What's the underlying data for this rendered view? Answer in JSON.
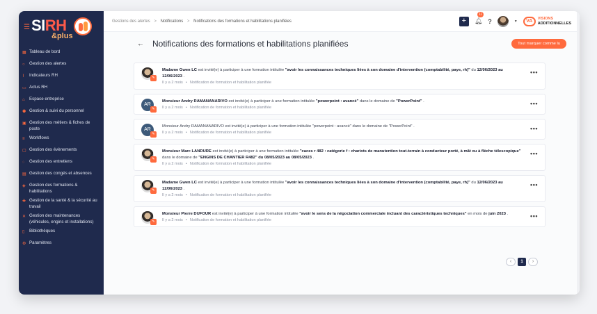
{
  "sidebar": {
    "logo_main": "SIRH",
    "logo_plus": "&plus",
    "items": [
      {
        "label": "Tableau de bord",
        "icon": "grid-icon"
      },
      {
        "label": "Gestion des alertes",
        "icon": "bell-icon"
      },
      {
        "label": "Indicateurs RH",
        "icon": "chart-icon"
      },
      {
        "label": "Actus RH",
        "icon": "news-icon"
      },
      {
        "label": "Espace entreprise",
        "icon": "building-icon"
      },
      {
        "label": "Gestion & suivi du personnel",
        "icon": "users-icon"
      },
      {
        "label": "Gestion des métiers & fiches de poste",
        "icon": "briefcase-icon"
      },
      {
        "label": "Workflows",
        "icon": "workflow-icon"
      },
      {
        "label": "Gestion des évènements",
        "icon": "calendar-icon"
      },
      {
        "label": "Gestion des entretiens",
        "icon": "chat-icon"
      },
      {
        "label": "Gestion des congés et absences",
        "icon": "calendar-off-icon"
      },
      {
        "label": "Gestion des formations & habilitations",
        "icon": "graduation-icon"
      },
      {
        "label": "Gestion de la santé & la sécurité au travail",
        "icon": "health-icon"
      },
      {
        "label": "Gestion des maintenances (véhicules, engins et installations)",
        "icon": "wrench-icon"
      },
      {
        "label": "Bibliothèques",
        "icon": "book-icon"
      },
      {
        "label": "Paramètres",
        "icon": "gear-icon"
      }
    ]
  },
  "breadcrumb": {
    "items": [
      "Gestions des alertes",
      "Notifications",
      "Notifications des formations et habilitations planifiées"
    ]
  },
  "topbar": {
    "notification_count": "11",
    "help": "?",
    "brand_line1": "VISIONS",
    "brand_line2": "ADDITIONNELLES",
    "brand_mark": "VA"
  },
  "page": {
    "title": "Notifications des formations et habilitations planifiées",
    "mark_all_label": "Tout marquer comme lu"
  },
  "notifications": [
    {
      "avatar": "photo",
      "initials": "",
      "name": "Madame Gwen LC",
      "text1": " est invité(e) à participer à une formation intitulée ",
      "training": "\"avoir les connaissances techniques liées à son domaine d'intervention (comptabilité, paye, rh)\"",
      "text2": " du ",
      "domain": "",
      "dates": "12/06/2023 au 12/06/2023",
      "ending": " .",
      "bold": true,
      "time": "Il y a 2 mois",
      "type": "Notification de formation et habilitation planifiée"
    },
    {
      "avatar": "initials",
      "initials": "AR",
      "name": "Monsieur Andry RAMANANARIVO",
      "text1": " est invité(e) à participer à une formation intitulée ",
      "training": "\"powerpoint : avancé\"",
      "text2": " dans le domaine de ",
      "domain": "\"PowerPoint\"",
      "dates": "",
      "ending": " .",
      "bold": true,
      "time": "Il y a 2 mois",
      "type": "Notification de formation et habilitation planifiée"
    },
    {
      "avatar": "initials",
      "initials": "AR",
      "name": "Monsieur Andry RAMANANARIVO",
      "text1": " est invité(e) à participer à une formation intitulée ",
      "training": "\"powerpoint : avancé\"",
      "text2": " dans le domaine de ",
      "domain": "\"PowerPoint\"",
      "dates": "",
      "ending": " .",
      "bold": false,
      "time": "Il y a 2 mois",
      "type": "Notification de formation et habilitation planifiée"
    },
    {
      "avatar": "photo",
      "initials": "",
      "name": "Monsieur Marc LANDURE",
      "text1": " est invité(e) à participer à une formation intitulée ",
      "training": "\"caces r 482 : catégorie f : chariots de manutention tout-terrain à conducteur porté, à mât ou à flèche télescopique\"",
      "text2": " dans le domaine de ",
      "domain": "\"ENGINS DE CHANTIER R482\"",
      "dates": "du 08/05/2023 au 08/05/2023",
      "ending": " .",
      "bold": true,
      "time": "Il y a 2 mois",
      "type": "Notification de formation et habilitation planifiée"
    },
    {
      "avatar": "photo",
      "initials": "",
      "name": "Madame Gwen LC",
      "text1": " est invité(e) à participer à une formation intitulée ",
      "training": "\"avoir les connaissances techniques liées à son domaine d'intervention (comptabilité, paye, rh)\"",
      "text2": " du ",
      "domain": "",
      "dates": "12/06/2023 au 12/06/2023",
      "ending": " .",
      "bold": true,
      "time": "Il y a 2 mois",
      "type": "Notification de formation et habilitation planifiée"
    },
    {
      "avatar": "photo",
      "initials": "",
      "name": "Monsieur Pierre DUFOUR",
      "text1": " est invité(e) à participer à une formation intitulée ",
      "training": "\"avoir le sens de la négociation commerciale incluant des caractéristiques techniques\"",
      "text2": " en mois de ",
      "domain": "",
      "dates": "juin 2023",
      "ending": " .",
      "bold": true,
      "time": "Il y a 2 mois",
      "type": "Notification de formation et habilitation planifiée"
    }
  ],
  "pagination": {
    "current": "1",
    "prev": "‹",
    "next": "›"
  },
  "colors": {
    "accent": "#ff6a3d",
    "sidebar_bg": "#1f2a4d"
  }
}
